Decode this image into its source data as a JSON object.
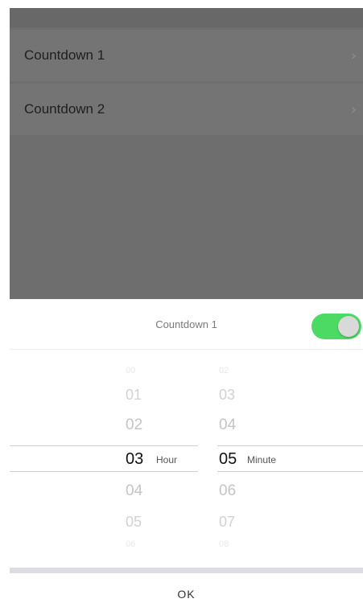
{
  "list": {
    "items": [
      {
        "label": "Countdown 1",
        "chevron": "›"
      },
      {
        "label": "Countdown 2",
        "chevron": "›"
      }
    ]
  },
  "sheet": {
    "title": "Countdown 1",
    "toggle_on": true,
    "toggle_color": "#4cd964"
  },
  "hour_picker": {
    "unit": "Hour",
    "values": [
      "00",
      "01",
      "02",
      "03",
      "04",
      "05",
      "06"
    ],
    "selected": "03"
  },
  "minute_picker": {
    "unit": "Minute",
    "values": [
      "02",
      "03",
      "04",
      "05",
      "06",
      "07",
      "08"
    ],
    "selected": "05"
  },
  "actions": {
    "ok_label": "OK"
  }
}
